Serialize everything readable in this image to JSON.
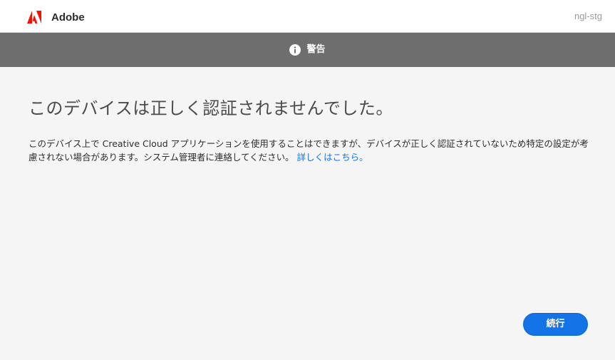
{
  "header": {
    "brand": "Adobe",
    "environment": "ngl-stg",
    "logo_color": "#fa0f00"
  },
  "warning_bar": {
    "icon": "info-icon",
    "label": "警告"
  },
  "main": {
    "title": "このデバイスは正しく認証されませんでした。",
    "description": "このデバイス上で Creative Cloud アプリケーションを使用することはできますが、デバイスが正しく認証されていないため特定の設定が考慮されない場合があります。システム管理者に連絡してください。",
    "learn_more_link": "詳しくはこちら。"
  },
  "actions": {
    "continue_label": "続行"
  },
  "colors": {
    "accent": "#1473e6",
    "warning_bar": "#6e6e6e",
    "background": "#f5f5f5"
  }
}
